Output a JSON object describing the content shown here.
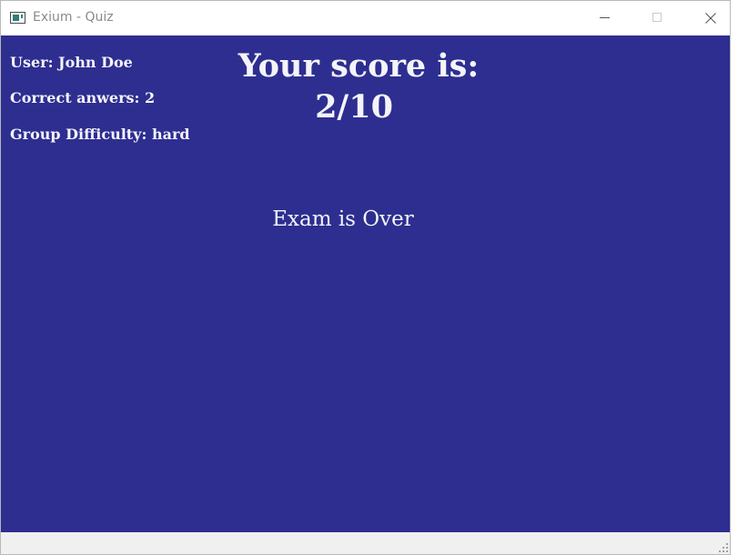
{
  "window": {
    "title": "Exium - Quiz"
  },
  "stats": {
    "user": "User: John Doe",
    "correct_answers": "Correct anwers: 2",
    "group_difficulty": "Group Difficulty: hard"
  },
  "score": {
    "label": "Your score is:",
    "value": "2/10"
  },
  "status_message": "Exam is Over",
  "icons": {
    "app": "app-window-icon",
    "minimize": "minimize-icon",
    "maximize": "maximize-icon",
    "close": "close-icon",
    "resize": "resize-grip-icon"
  },
  "colors": {
    "background": "#2d2e90",
    "text": "#f4f4f8",
    "titlebar": "#ffffff",
    "statusbar": "#f0f0f0"
  }
}
